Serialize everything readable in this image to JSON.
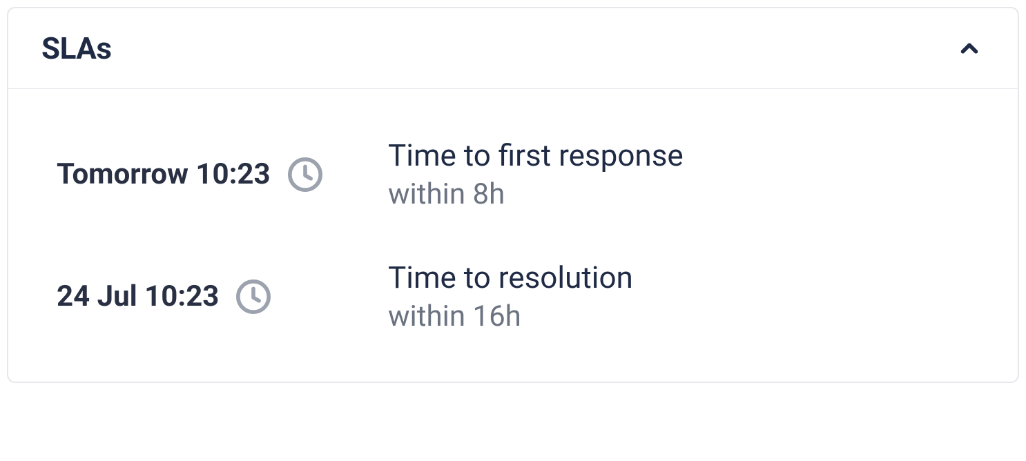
{
  "panel": {
    "title": "SLAs"
  },
  "slas": [
    {
      "deadline": "Tomorrow 10:23",
      "name": "Time to first response",
      "target": "within 8h"
    },
    {
      "deadline": "24 Jul 10:23",
      "name": "Time to resolution",
      "target": "within 16h"
    }
  ]
}
